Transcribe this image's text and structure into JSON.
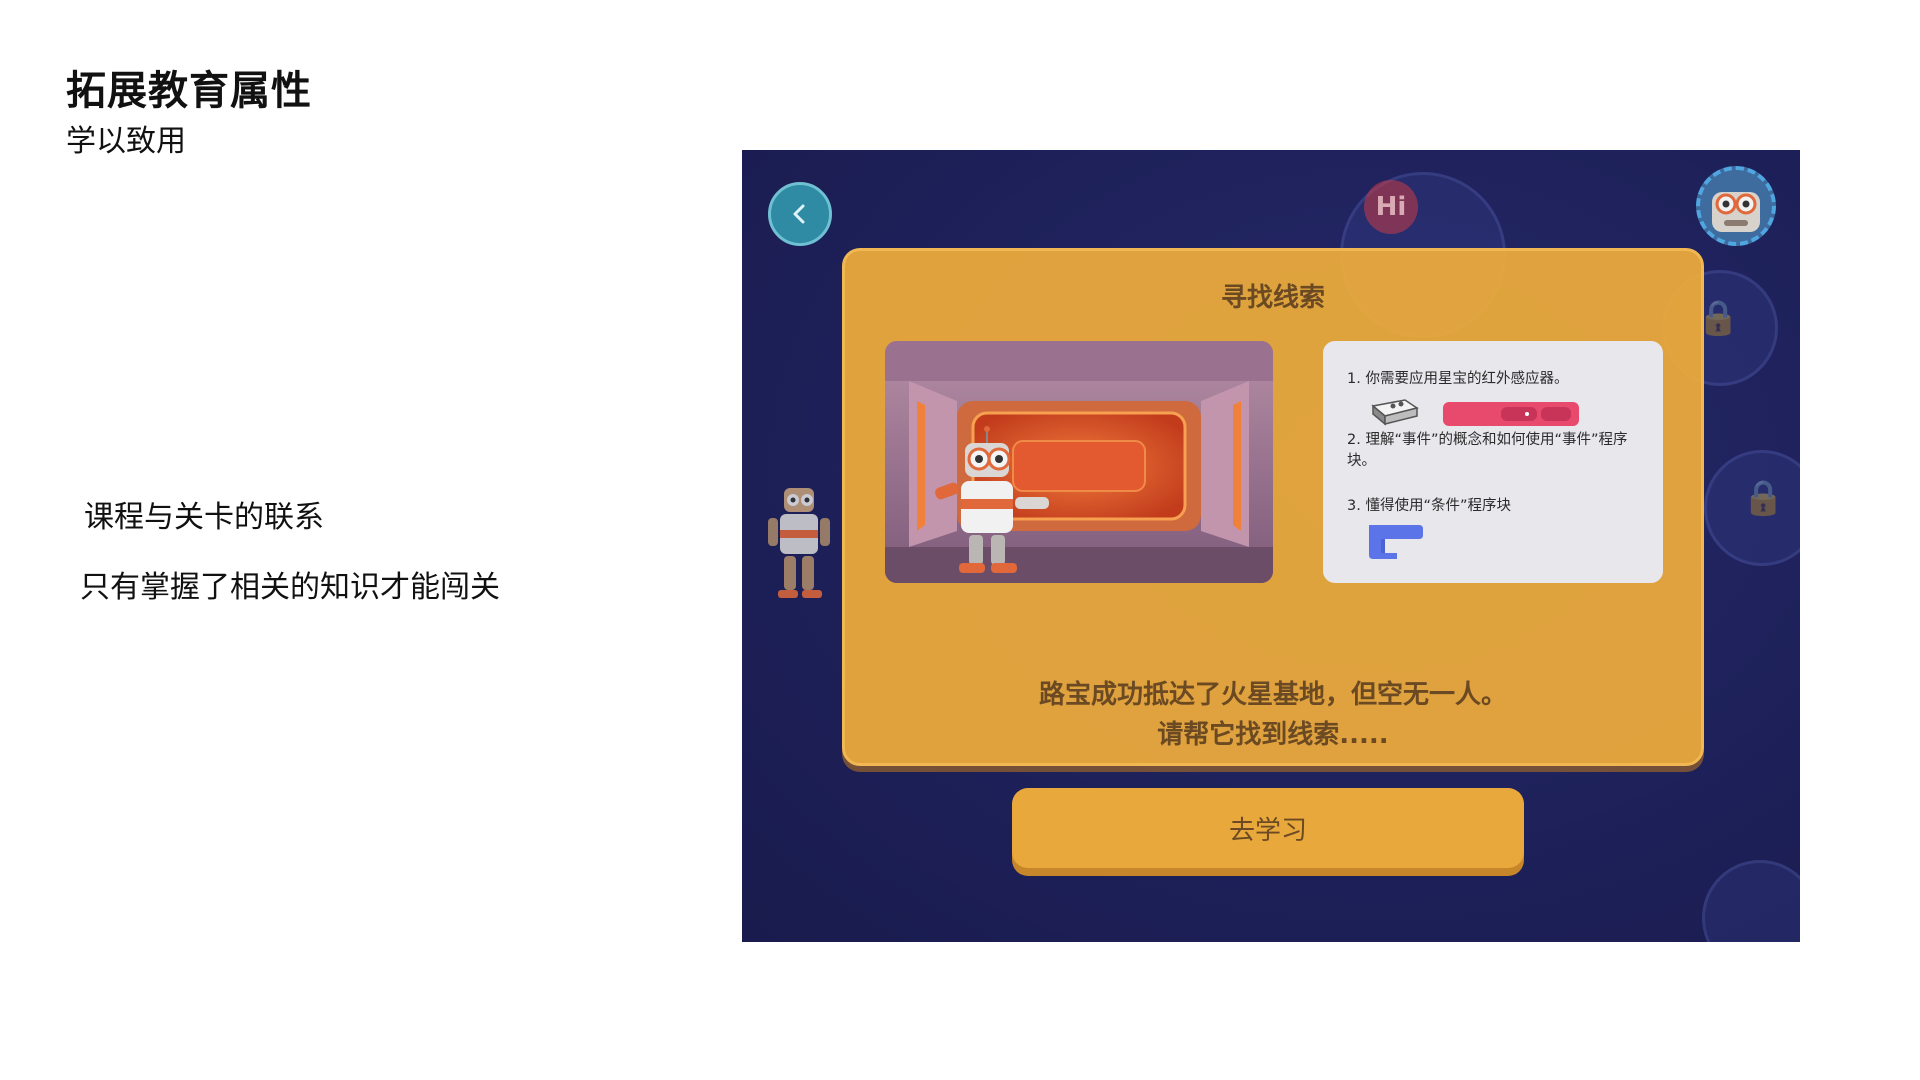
{
  "slide": {
    "title": "拓展教育属性",
    "subtitle": "学以致用",
    "points": [
      "课程与关卡的联系",
      "只有掌握了相关的知识才能闯关"
    ]
  },
  "game": {
    "background_badge": "Hi",
    "dialog": {
      "title": "寻找线索",
      "info_items": [
        "1. 你需要应用星宝的红外感应器。",
        "2. 理解“事件”的概念和如何使用“事件”程序块。",
        "3. 懂得使用“条件”程序块"
      ],
      "message_line1": "路宝成功抵达了火星基地，但空无一人。",
      "message_line2": "请帮它找到线索....."
    },
    "learn_button": "去学习",
    "colors": {
      "background": "#1e215a",
      "dialog": "#eaaa3c",
      "button": "#e9a83c",
      "text": "#6b4a23",
      "event_block": "#e84a6e",
      "condition_block": "#5b74e8",
      "back_button": "#2f8aa3"
    },
    "icons": [
      "back-arrow-icon",
      "lock-icon",
      "robot-avatar-icon",
      "infrared-sensor-icon",
      "event-block-icon",
      "condition-block-icon"
    ]
  }
}
